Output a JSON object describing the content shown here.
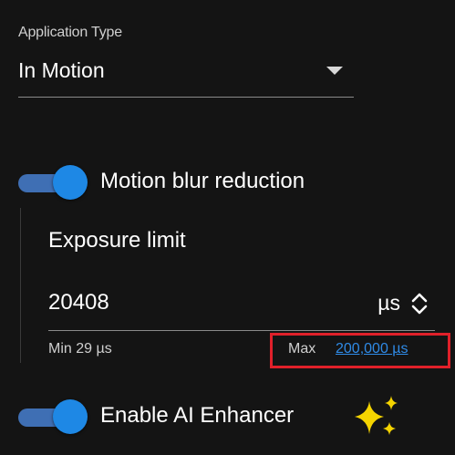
{
  "application_type": {
    "label": "Application Type",
    "value": "In Motion"
  },
  "motion_blur": {
    "label": "Motion blur reduction",
    "enabled": true
  },
  "exposure_limit": {
    "title": "Exposure limit",
    "value": "20408",
    "unit": "µs",
    "min_text": "Min 29 µs",
    "max_label": "Max",
    "max_link": "200,000 µs"
  },
  "ai_enhancer": {
    "label": "Enable AI Enhancer",
    "enabled": true
  },
  "icons": {
    "select": "chevron-down-icon",
    "stepper": "stepper-icon",
    "ai": "sparkle-icon"
  },
  "colors": {
    "background": "#141414",
    "accent": "#1e88e5",
    "track": "#3f6fb4",
    "link": "#2f8ae6",
    "highlight_box": "#e0202a",
    "sparkle": "#f5d400"
  }
}
